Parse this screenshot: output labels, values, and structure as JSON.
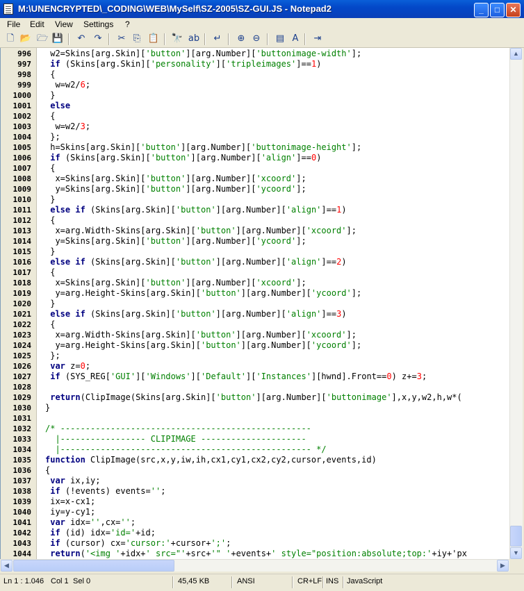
{
  "window": {
    "title": "M:\\UNENCRYPTED\\_CODING\\WEB\\MySelf\\SZ-2005\\SZ-GUI.JS - Notepad2"
  },
  "window_buttons": {
    "minimize": "_",
    "maximize": "□",
    "close": "✕"
  },
  "menu": [
    {
      "label": "File"
    },
    {
      "label": "Edit"
    },
    {
      "label": "View"
    },
    {
      "label": "Settings"
    },
    {
      "label": "?"
    }
  ],
  "toolbar": {
    "icons": [
      "new-file-icon",
      "open-folder-icon",
      "browse-icon",
      "save-icon",
      "undo-icon",
      "redo-icon",
      "cut-icon",
      "copy-icon",
      "paste-icon",
      "find-icon",
      "replace-icon",
      "word-wrap-icon",
      "zoom-in-icon",
      "zoom-out-icon",
      "scheme-icon",
      "font-icon",
      "exit-icon"
    ],
    "glyphs": [
      "🗋",
      "📂",
      "🗁",
      "💾",
      "↶",
      "↷",
      "✂",
      "⎘",
      "📋",
      "🔭",
      "ab",
      "↵",
      "⊕",
      "⊖",
      "▤",
      "A",
      "⇥"
    ]
  },
  "colors": {
    "keyword": "#000080",
    "string": "#008000",
    "number": "#ff0000",
    "comment": "#008000",
    "default": "#000000"
  },
  "editor": {
    "lines": [
      {
        "n": "996",
        "code": " w2=Skins[arg.Skin]['button'][arg.Number]['buttonimage-width'];"
      },
      {
        "n": "997",
        "code": " if (Skins[arg.Skin]['personality']['tripleimages']==1)"
      },
      {
        "n": "998",
        "code": " {"
      },
      {
        "n": "999",
        "code": "  w=w2/6;"
      },
      {
        "n": "1000",
        "code": " }"
      },
      {
        "n": "1001",
        "code": " else"
      },
      {
        "n": "1002",
        "code": " {"
      },
      {
        "n": "1003",
        "code": "  w=w2/3;"
      },
      {
        "n": "1004",
        "code": " };"
      },
      {
        "n": "1005",
        "code": " h=Skins[arg.Skin]['button'][arg.Number]['buttonimage-height'];"
      },
      {
        "n": "1006",
        "code": " if (Skins[arg.Skin]['button'][arg.Number]['align']==0)"
      },
      {
        "n": "1007",
        "code": " {"
      },
      {
        "n": "1008",
        "code": "  x=Skins[arg.Skin]['button'][arg.Number]['xcoord'];"
      },
      {
        "n": "1009",
        "code": "  y=Skins[arg.Skin]['button'][arg.Number]['ycoord'];"
      },
      {
        "n": "1010",
        "code": " }"
      },
      {
        "n": "1011",
        "code": " else if (Skins[arg.Skin]['button'][arg.Number]['align']==1)"
      },
      {
        "n": "1012",
        "code": " {"
      },
      {
        "n": "1013",
        "code": "  x=arg.Width-Skins[arg.Skin]['button'][arg.Number]['xcoord'];"
      },
      {
        "n": "1014",
        "code": "  y=Skins[arg.Skin]['button'][arg.Number]['ycoord'];"
      },
      {
        "n": "1015",
        "code": " }"
      },
      {
        "n": "1016",
        "code": " else if (Skins[arg.Skin]['button'][arg.Number]['align']==2)"
      },
      {
        "n": "1017",
        "code": " {"
      },
      {
        "n": "1018",
        "code": "  x=Skins[arg.Skin]['button'][arg.Number]['xcoord'];"
      },
      {
        "n": "1019",
        "code": "  y=arg.Height-Skins[arg.Skin]['button'][arg.Number]['ycoord'];"
      },
      {
        "n": "1020",
        "code": " }"
      },
      {
        "n": "1021",
        "code": " else if (Skins[arg.Skin]['button'][arg.Number]['align']==3)"
      },
      {
        "n": "1022",
        "code": " {"
      },
      {
        "n": "1023",
        "code": "  x=arg.Width-Skins[arg.Skin]['button'][arg.Number]['xcoord'];"
      },
      {
        "n": "1024",
        "code": "  y=arg.Height-Skins[arg.Skin]['button'][arg.Number]['ycoord'];"
      },
      {
        "n": "1025",
        "code": " };"
      },
      {
        "n": "1026",
        "code": " var z=0;"
      },
      {
        "n": "1027",
        "code": " if (SYS_REG['GUI']['Windows']['Default']['Instances'][hwnd].Front==0) z+=3;"
      },
      {
        "n": "1028",
        "code": " "
      },
      {
        "n": "1029",
        "code": " return(ClipImage(Skins[arg.Skin]['button'][arg.Number]['buttonimage'],x,y,w2,h,w*("
      },
      {
        "n": "1030",
        "code": "}"
      },
      {
        "n": "1031",
        "code": ""
      },
      {
        "n": "1032",
        "code": "/* --------------------------------------------------"
      },
      {
        "n": "1033",
        "code": "  |----------------- CLIPIMAGE ---------------------"
      },
      {
        "n": "1034",
        "code": "  |-------------------------------------------------- */"
      },
      {
        "n": "1035",
        "code": "function ClipImage(src,x,y,iw,ih,cx1,cy1,cx2,cy2,cursor,events,id)"
      },
      {
        "n": "1036",
        "code": "{"
      },
      {
        "n": "1037",
        "code": " var ix,iy;"
      },
      {
        "n": "1038",
        "code": " if (!events) events='';"
      },
      {
        "n": "1039",
        "code": " ix=x-cx1;"
      },
      {
        "n": "1040",
        "code": " iy=y-cy1;"
      },
      {
        "n": "1041",
        "code": " var idx='',cx='';"
      },
      {
        "n": "1042",
        "code": " if (id) idx='id='+id;"
      },
      {
        "n": "1043",
        "code": " if (cursor) cx='cursor:'+cursor+';';"
      },
      {
        "n": "1044",
        "code": " return('<img '+idx+' src=\"'+src+'\" '+events+' style=\"position:absolute;top:'+iy+'px"
      }
    ]
  },
  "statusbar": {
    "position": "Ln 1 : 1.046",
    "col": "Col 1",
    "sel": "Sel 0",
    "size": "45,45 KB",
    "encoding": "ANSI",
    "eol": "CR+LF",
    "ins": "INS",
    "lexer": "JavaScript"
  }
}
